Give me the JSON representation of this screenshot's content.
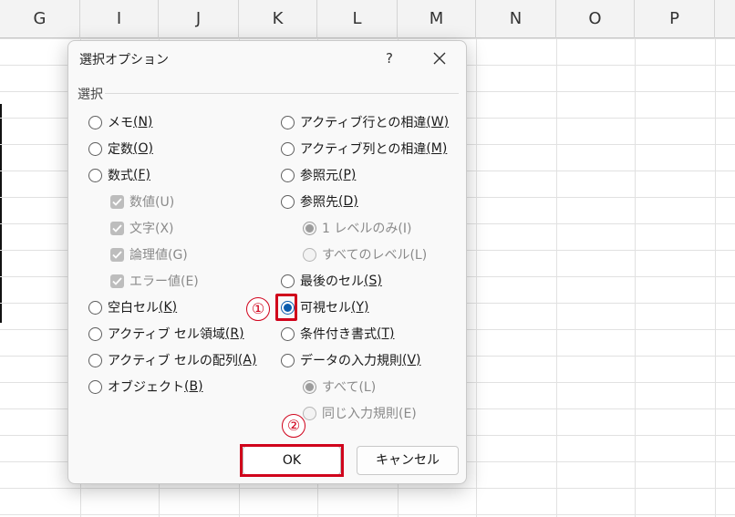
{
  "sheet": {
    "columns": [
      "G",
      "I",
      "J",
      "K",
      "L",
      "M",
      "N",
      "O",
      "P"
    ]
  },
  "dialog": {
    "title": "選択オプション",
    "help_label": "?",
    "group_label": "選択",
    "left_options": [
      {
        "label": "メモ",
        "key": "(N)",
        "type": "radio",
        "selected": false,
        "disabled": false
      },
      {
        "label": "定数",
        "key": "(O)",
        "type": "radio",
        "selected": false,
        "disabled": false
      },
      {
        "label": "数式",
        "key": "(F)",
        "type": "radio",
        "selected": false,
        "disabled": false
      },
      {
        "label": "数値(U)",
        "key": "",
        "type": "checkbox",
        "checked": true,
        "disabled": true
      },
      {
        "label": "文字(X)",
        "key": "",
        "type": "checkbox",
        "checked": true,
        "disabled": true
      },
      {
        "label": "論理値(G)",
        "key": "",
        "type": "checkbox",
        "checked": true,
        "disabled": true
      },
      {
        "label": "エラー値(E)",
        "key": "",
        "type": "checkbox",
        "checked": true,
        "disabled": true
      },
      {
        "label": "空白セル",
        "key": "(K)",
        "type": "radio",
        "selected": false,
        "disabled": false
      },
      {
        "label": "アクティブ セル領域",
        "key": "(R)",
        "type": "radio",
        "selected": false,
        "disabled": false
      },
      {
        "label": "アクティブ セルの配列",
        "key": "(A)",
        "type": "radio",
        "selected": false,
        "disabled": false
      },
      {
        "label": "オブジェクト",
        "key": "(B)",
        "type": "radio",
        "selected": false,
        "disabled": false
      }
    ],
    "right_options": [
      {
        "label": "アクティブ行との相違",
        "key": "(W)",
        "type": "radio",
        "selected": false,
        "disabled": false
      },
      {
        "label": "アクティブ列との相違",
        "key": "(M)",
        "type": "radio",
        "selected": false,
        "disabled": false
      },
      {
        "label": "参照元",
        "key": "(P)",
        "type": "radio",
        "selected": false,
        "disabled": false
      },
      {
        "label": "参照先",
        "key": "(D)",
        "type": "radio",
        "selected": false,
        "disabled": false
      },
      {
        "label": "1 レベルのみ(I)",
        "key": "",
        "type": "radio",
        "selected": true,
        "disabled": true
      },
      {
        "label": "すべてのレベル(L)",
        "key": "",
        "type": "radio",
        "selected": false,
        "disabled": true
      },
      {
        "label": "最後のセル",
        "key": "(S)",
        "type": "radio",
        "selected": false,
        "disabled": false
      },
      {
        "label": "可視セル",
        "key": "(Y)",
        "type": "radio",
        "selected": true,
        "disabled": false
      },
      {
        "label": "条件付き書式",
        "key": "(T)",
        "type": "radio",
        "selected": false,
        "disabled": false
      },
      {
        "label": "データの入力規則",
        "key": "(V)",
        "type": "radio",
        "selected": false,
        "disabled": false
      },
      {
        "label": "すべて(L)",
        "key": "",
        "type": "radio",
        "selected": true,
        "disabled": true
      },
      {
        "label": "同じ入力規則(E)",
        "key": "",
        "type": "radio",
        "selected": false,
        "disabled": true
      }
    ],
    "ok_label": "OK",
    "cancel_label": "キャンセル"
  },
  "annotations": {
    "step1": "①",
    "step2": "②",
    "highlight_color": "#d0021b"
  },
  "colors": {
    "accent": "#0b5cad",
    "disabled_text": "#8a8a8a"
  }
}
